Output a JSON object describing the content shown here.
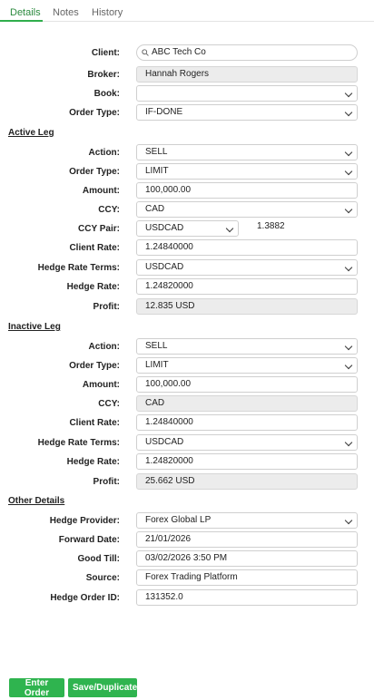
{
  "tabs": [
    "Details",
    "Notes",
    "History"
  ],
  "header": {
    "client_label": "Client:",
    "client_value": "ABC Tech Co",
    "broker_label": "Broker:",
    "broker_value": "Hannah Rogers",
    "book_label": "Book:",
    "book_value": "",
    "order_type_label": "Order Type:",
    "order_type_value": "IF-DONE"
  },
  "active_leg": {
    "title": "Active Leg",
    "action_label": "Action:",
    "action_value": "SELL",
    "order_type_label": "Order Type:",
    "order_type_value": "LIMIT",
    "amount_label": "Amount:",
    "amount_value": "100,000.00",
    "ccy_label": "CCY:",
    "ccy_value": "CAD",
    "ccy_pair_label": "CCY Pair:",
    "ccy_pair_value": "USDCAD",
    "ccy_pair_rate": "1.3882",
    "client_rate_label": "Client Rate:",
    "client_rate_value": "1.24840000",
    "hedge_terms_label": "Hedge Rate Terms:",
    "hedge_terms_value": "USDCAD",
    "hedge_rate_label": "Hedge Rate:",
    "hedge_rate_value": "1.24820000",
    "profit_label": "Profit:",
    "profit_value": "12.835 USD"
  },
  "inactive_leg": {
    "title": "Inactive Leg",
    "action_label": "Action:",
    "action_value": "SELL",
    "order_type_label": "Order Type:",
    "order_type_value": "LIMIT",
    "amount_label": "Amount:",
    "amount_value": "100,000.00",
    "ccy_label": "CCY:",
    "ccy_value": "CAD",
    "client_rate_label": "Client Rate:",
    "client_rate_value": "1.24840000",
    "hedge_terms_label": "Hedge Rate Terms:",
    "hedge_terms_value": "USDCAD",
    "hedge_rate_label": "Hedge Rate:",
    "hedge_rate_value": "1.24820000",
    "profit_label": "Profit:",
    "profit_value": "25.662 USD"
  },
  "other": {
    "title": "Other Details",
    "provider_label": "Hedge Provider:",
    "provider_value": "Forex Global LP",
    "forward_label": "Forward Date:",
    "forward_value": "21/01/2026",
    "good_till_label": "Good Till:",
    "good_till_value": "03/02/2026 3:50 PM",
    "source_label": "Source:",
    "source_value": "Forex Trading Platform",
    "order_id_label": "Hedge Order ID:",
    "order_id_value": "131352.0"
  },
  "buttons": {
    "enter": "Enter Order",
    "save": "Save/Duplicate"
  }
}
